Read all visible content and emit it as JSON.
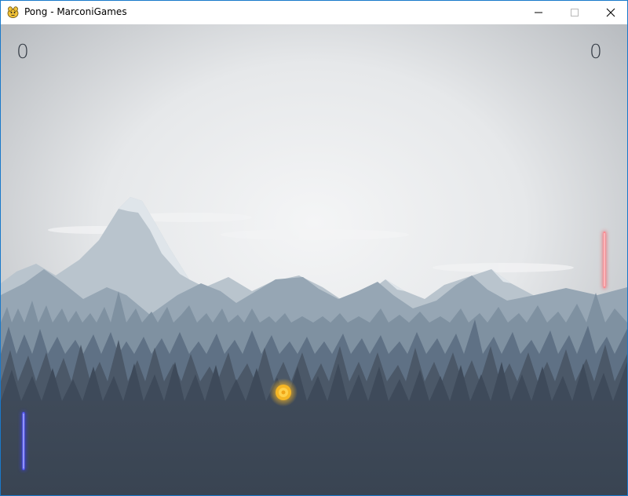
{
  "window": {
    "title": "Pong - MarconiGames",
    "icon": "pygame-snake-icon",
    "controls": [
      "minimize-icon",
      "maximize-icon",
      "close-icon"
    ]
  },
  "scores": {
    "left": "0",
    "right": "0"
  },
  "colors": {
    "sky": "#e9ecef",
    "ball": "#f5b625",
    "left_paddle": "#3a3df0",
    "right_paddle": "#f0535c",
    "forest_front": "#3b4756"
  }
}
